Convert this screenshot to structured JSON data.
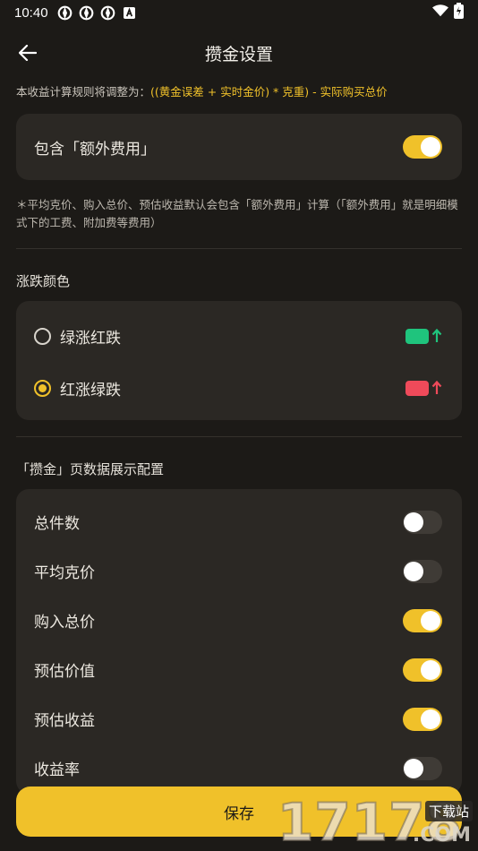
{
  "status_bar": {
    "time": "10:40"
  },
  "header": {
    "title": "攒金设置"
  },
  "rule_note": {
    "prefix": "本收益计算规则将调整为：",
    "formula": "((黄金误差 + 实时金价) * 克重) - 实际购买总价"
  },
  "extra_fee": {
    "label": "包含「额外费用」",
    "enabled": true
  },
  "footnote": "＊平均克价、购入总价、预估收益默认会包含「额外费用」计算（「额外费用」就是明细模式下的工费、附加费等费用）",
  "color_section": {
    "title": "涨跌颜色",
    "options": [
      {
        "label": "绿涨红跌",
        "selected": false,
        "swatch_color": "#1fc47d"
      },
      {
        "label": "红涨绿跌",
        "selected": true,
        "swatch_color": "#ef4a5a"
      }
    ]
  },
  "display_section": {
    "title": "「攒金」页数据展示配置",
    "items": [
      {
        "label": "总件数",
        "enabled": false
      },
      {
        "label": "平均克价",
        "enabled": false
      },
      {
        "label": "购入总价",
        "enabled": true
      },
      {
        "label": "预估价值",
        "enabled": true
      },
      {
        "label": "预估收益",
        "enabled": true
      },
      {
        "label": "收益率",
        "enabled": false
      }
    ]
  },
  "save_button": {
    "label": "保存"
  },
  "watermark": {
    "digits": "17178",
    "tag": "下载站",
    "suffix": ".COM"
  },
  "colors": {
    "accent": "#f0c12a",
    "background": "#1c1a17",
    "card": "#2b2824"
  }
}
